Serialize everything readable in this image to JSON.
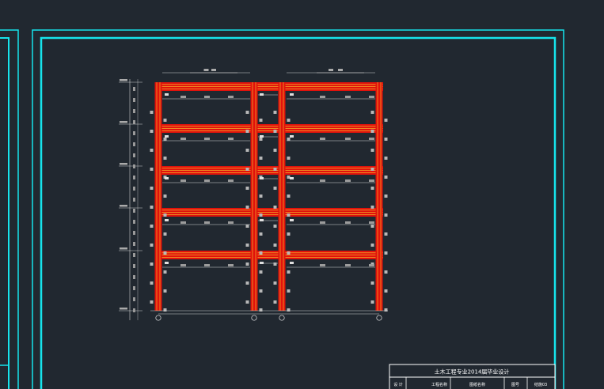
{
  "drawing": {
    "background": "#212830",
    "frame_color": "#16e4ec",
    "beam_color": "#e1120c",
    "rebar_color": "#f5ce2d",
    "grid_labels": [
      "①",
      "②",
      "③",
      "④"
    ]
  },
  "title_block": {
    "title": "土木工程专业2014届毕业设计",
    "row_labels": [
      "设 计",
      "工程名称",
      "图纸名称",
      "图号",
      "结施03"
    ]
  }
}
